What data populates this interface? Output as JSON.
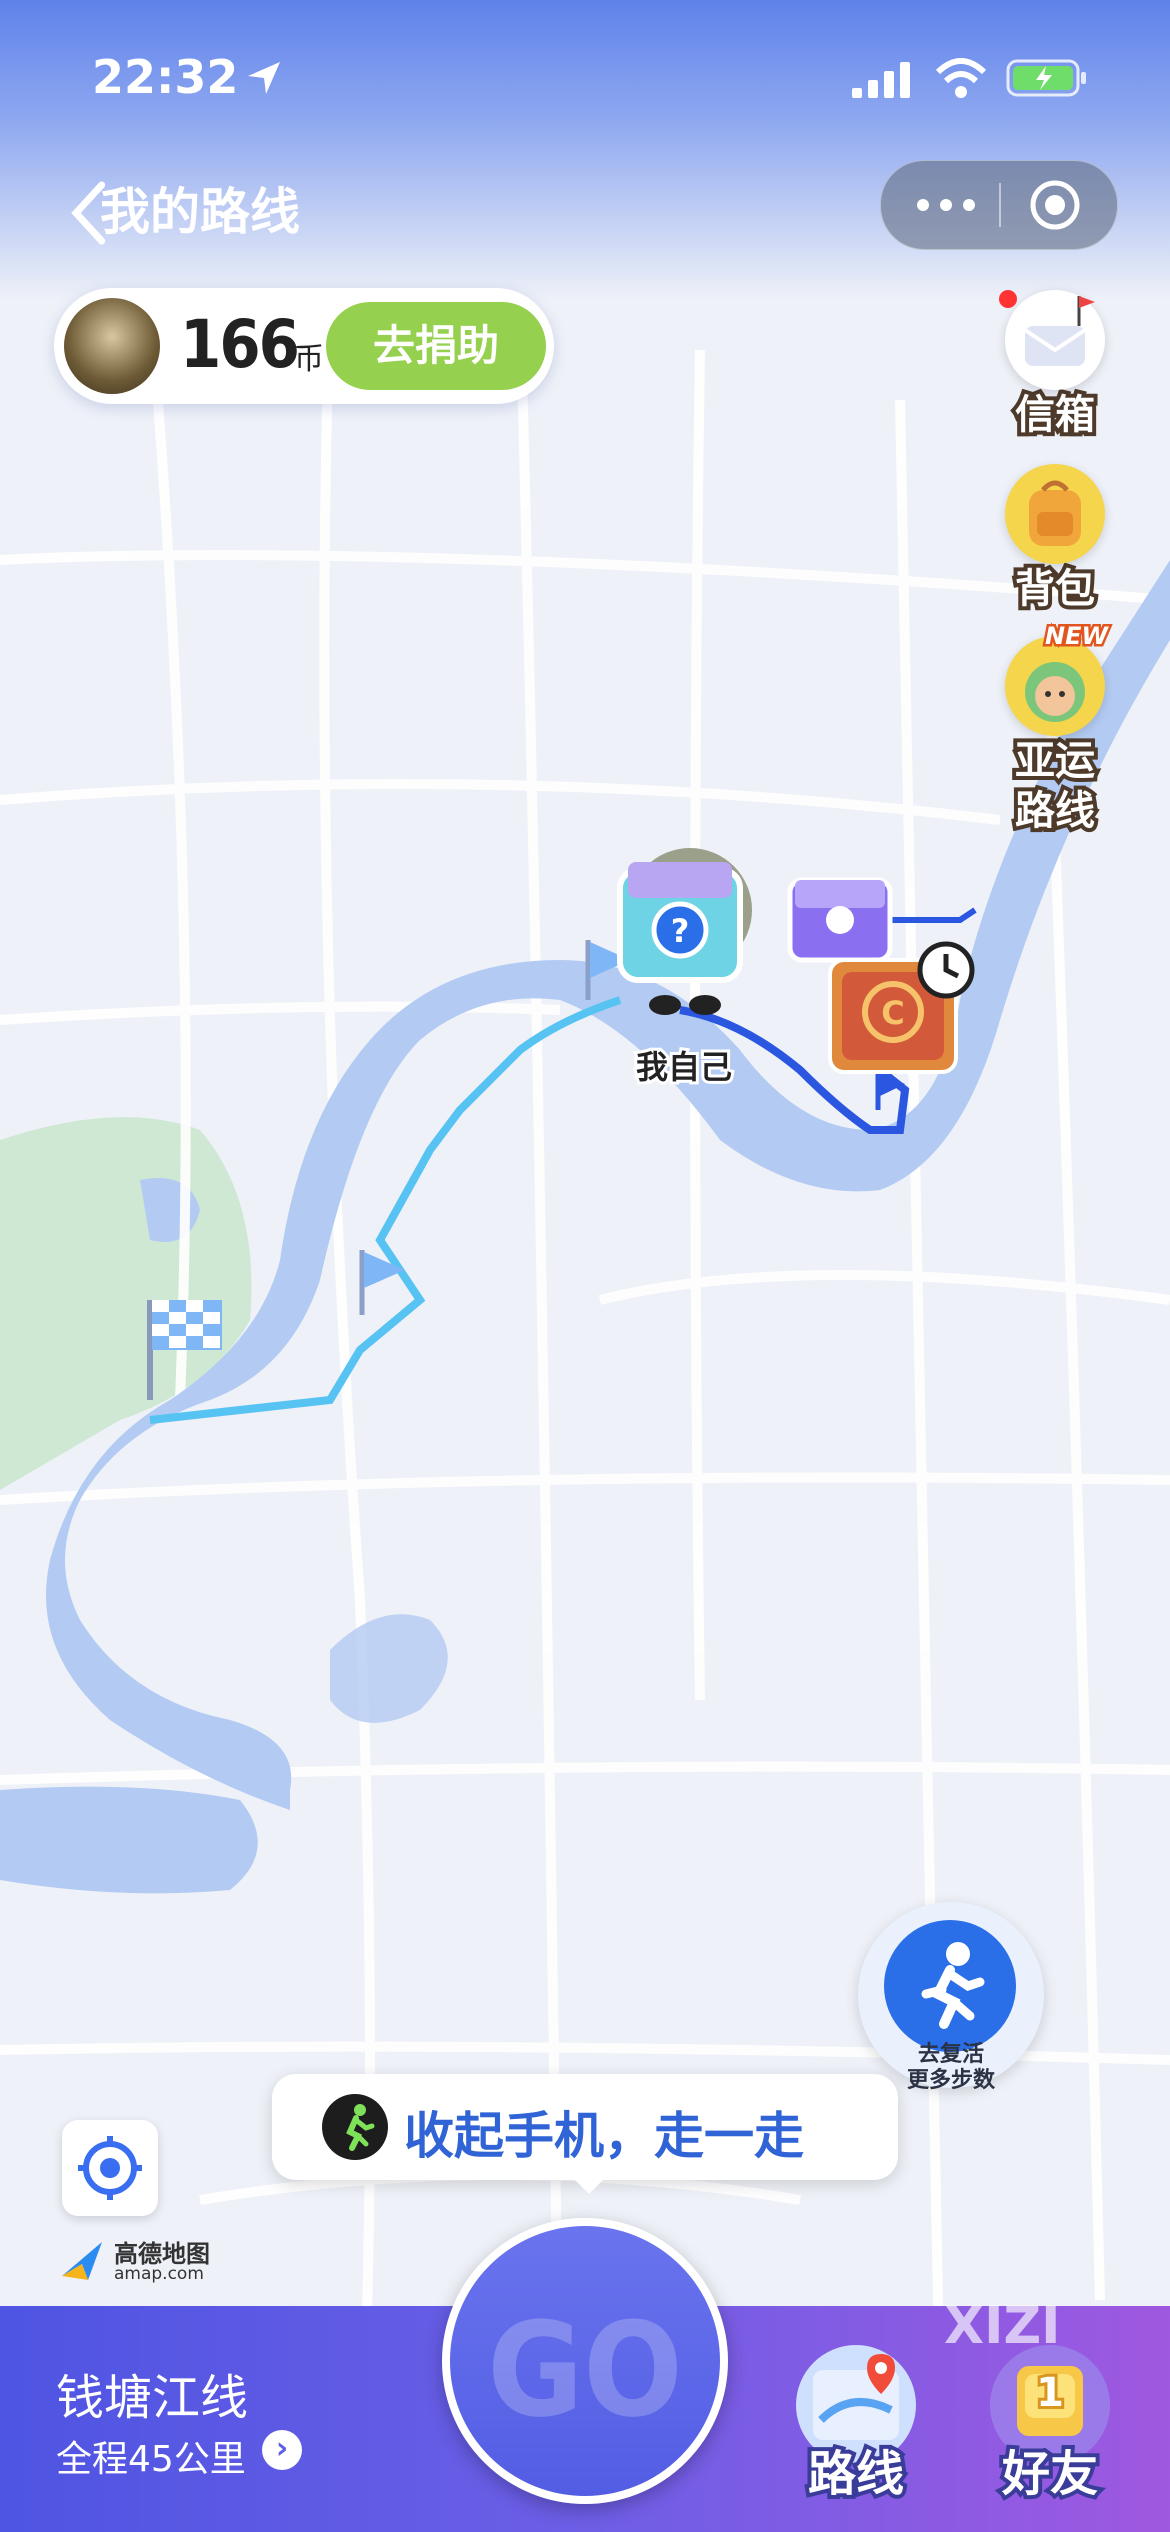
{
  "status_bar": {
    "time": "22:32"
  },
  "header": {
    "back_label": "我的路线"
  },
  "user": {
    "coins": "166",
    "coin_unit": "币",
    "donate_label": "去捐助"
  },
  "side_menu": [
    {
      "label": "信箱",
      "icon": "mailbox-icon"
    },
    {
      "label": "背包",
      "icon": "backpack-icon"
    },
    {
      "label": "亚运\n路线",
      "icon": "asian-games-mascot-icon",
      "badge": "NEW"
    }
  ],
  "map": {
    "me_label": "我自己"
  },
  "revive_button": {
    "line1": "去复活",
    "line2": "更多步数"
  },
  "toast": {
    "text": "收起手机，走一走"
  },
  "amap": {
    "cn": "高德地图",
    "en": "amap.com"
  },
  "bottom": {
    "route_name": "钱塘江线",
    "route_length": "全程45公里",
    "go_label": "GO",
    "tab_route": "路线",
    "tab_friends": "好友",
    "friends_badge": "1",
    "watermark": "XIZI"
  },
  "colors": {
    "accent": "#5a5ee4",
    "river": "#b3cbf3",
    "route_walked": "#2a56e0",
    "route_planned": "#56c3f2",
    "donate": "#96d04f"
  }
}
